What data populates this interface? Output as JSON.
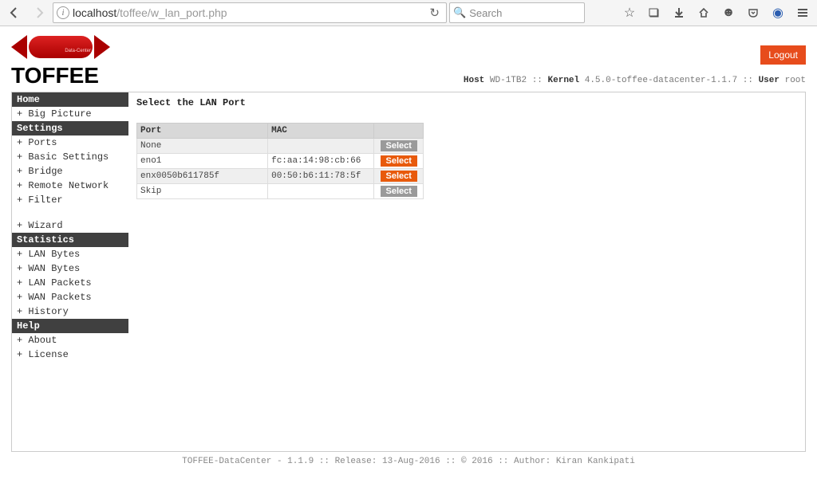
{
  "browser": {
    "url_host": "localhost",
    "url_path": "/toffee/w_lan_port.php",
    "search_placeholder": "Search"
  },
  "header": {
    "logo_text": "TOFFEE",
    "logo_sub": "Data-Center",
    "logout": "Logout",
    "host_label": "Host",
    "host_val": "WD-1TB2",
    "kernel_label": "Kernel",
    "kernel_val": "4.5.0-toffee-datacenter-1.1.7",
    "user_label": "User",
    "user_val": "root"
  },
  "sidebar": {
    "home": "Home",
    "big_picture": "Big Picture",
    "settings": "Settings",
    "ports": "Ports",
    "basic_settings": "Basic Settings",
    "bridge": "Bridge",
    "remote_network": "Remote Network",
    "filter": "Filter",
    "wizard": "Wizard",
    "statistics": "Statistics",
    "lan_bytes": "LAN Bytes",
    "wan_bytes": "WAN Bytes",
    "lan_packets": "LAN Packets",
    "wan_packets": "WAN Packets",
    "history": "History",
    "help": "Help",
    "about": "About",
    "license": "License"
  },
  "main": {
    "title": "Select the LAN Port",
    "col_port": "Port",
    "col_mac": "MAC",
    "select_label": "Select",
    "rows": [
      {
        "port": "None",
        "mac": "",
        "active": false
      },
      {
        "port": "eno1",
        "mac": "fc:aa:14:98:cb:66",
        "active": true
      },
      {
        "port": "enx0050b611785f",
        "mac": "00:50:b6:11:78:5f",
        "active": true
      },
      {
        "port": "Skip",
        "mac": "",
        "active": false
      }
    ]
  },
  "footer": "TOFFEE-DataCenter - 1.1.9 :: Release: 13-Aug-2016 :: © 2016 :: Author: Kiran Kankipati"
}
